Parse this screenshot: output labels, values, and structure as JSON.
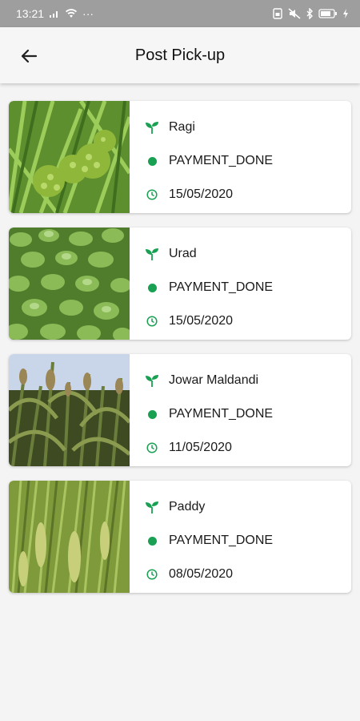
{
  "status_bar": {
    "time": "13:21",
    "more": "···"
  },
  "app_bar": {
    "title": "Post Pick-up"
  },
  "colors": {
    "accent": "#1aa053"
  },
  "items": [
    {
      "crop": "Ragi",
      "status": "PAYMENT_DONE",
      "date": "15/05/2020",
      "image": "ragi-crop-photo"
    },
    {
      "crop": "Urad",
      "status": "PAYMENT_DONE",
      "date": "15/05/2020",
      "image": "urad-crop-photo"
    },
    {
      "crop": "Jowar Maldandi",
      "status": "PAYMENT_DONE",
      "date": "11/05/2020",
      "image": "jowar-crop-photo"
    },
    {
      "crop": "Paddy",
      "status": "PAYMENT_DONE",
      "date": "08/05/2020",
      "image": "paddy-crop-photo"
    }
  ]
}
